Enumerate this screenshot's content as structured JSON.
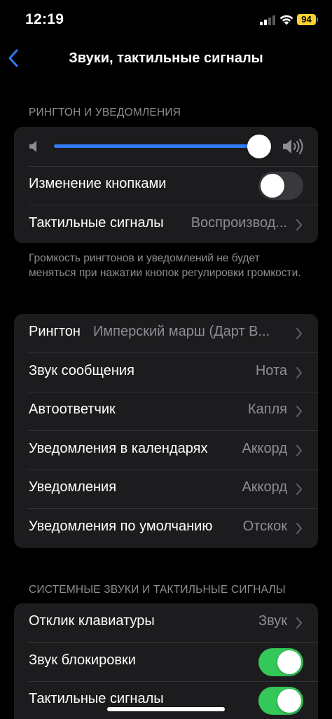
{
  "status_bar": {
    "time": "12:19",
    "battery": "94",
    "signal_icon": "cellular-signal-icon",
    "wifi_icon": "wifi-icon",
    "battery_color": "#f7d130"
  },
  "nav": {
    "back_icon": "chevron-left-icon",
    "title": "Звуки, тактильные сигналы",
    "accent_color": "#2f7bf6"
  },
  "ringer_section": {
    "header": "РИНГТОН И УВЕДОМЛЕНИЯ",
    "volume_level": 1.0,
    "change_with_buttons_label": "Изменение кнопками",
    "change_with_buttons_on": false,
    "haptics_label": "Тактильные сигналы",
    "haptics_value": "Воспроизвод...",
    "footer": "Громкость рингтонов и уведомлений не будет меняться при нажатии кнопок регулировки громкости."
  },
  "sounds": [
    {
      "label": "Рингтон",
      "value": "Имперский марш (Дарт В..."
    },
    {
      "label": "Звук сообщения",
      "value": "Нота"
    },
    {
      "label": "Автоответчик",
      "value": "Капля"
    },
    {
      "label": "Уведомления в календарях",
      "value": "Аккорд"
    },
    {
      "label": "Уведомления",
      "value": "Аккорд"
    },
    {
      "label": "Уведомления по умолчанию",
      "value": "Отскок"
    }
  ],
  "system_section": {
    "header": "СИСТЕМНЫЕ ЗВУКИ И ТАКТИЛЬНЫЕ СИГНАЛЫ",
    "keyboard_label": "Отклик клавиатуры",
    "keyboard_value": "Звук",
    "lock_sound_label": "Звук блокировки",
    "lock_sound_on": true,
    "system_haptics_label": "Тактильные сигналы",
    "system_haptics_on": true
  }
}
